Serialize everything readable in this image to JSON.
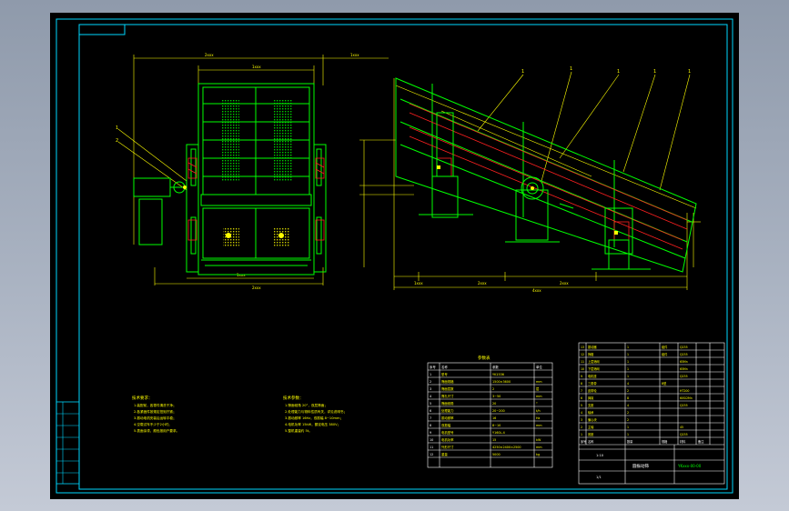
{
  "viewer": {
    "background": "#000000",
    "line_colors": {
      "frame": "#00d8ff",
      "outline": "#00ff00",
      "dimension": "#ffff00",
      "section": "#ff2020",
      "text": "#ffff00",
      "table": "#ffffff"
    },
    "cursor_icon": "crosshair-icon"
  },
  "drawing": {
    "front_view": {
      "dims_top": [
        "2xxx",
        "1xxx",
        "1xxx"
      ],
      "dims_bottom": [
        "1xxx",
        "2xxx"
      ],
      "callouts": [
        "1",
        "2"
      ]
    },
    "side_view": {
      "dims_bottom": [
        "1xxx",
        "2xxx",
        "2xxx",
        "4xxx"
      ],
      "callouts": [
        "1",
        "1",
        "1",
        "1",
        "1"
      ]
    },
    "tech_notes_left": {
      "title": "技术要求：",
      "lines": [
        "1.装配前，各零件清洗干净；",
        "2.各紧固件按规定扭矩拧紧；",
        "3.振动电机安装后运转平稳；",
        "4.空载试车不少于2小时；",
        "5.表面涂漆，颜色按用户要求。"
      ]
    },
    "tech_notes_right": {
      "title": "技术参数：",
      "lines": [
        "1.筛面倾角 20°，双层筛面；",
        "2.处理能力与物料性质有关，详见说明书；",
        "3.振动频率 16Hz，双振幅 8~10mm；",
        "4.电机功率 15kW，额定电压 380V；",
        "5.整机重量约 5t。"
      ]
    },
    "param_table": {
      "title": "参数表",
      "headers": [
        "序号",
        "名称",
        "参数",
        "单位"
      ],
      "rows": [
        [
          "1",
          "型号",
          "YK1536",
          ""
        ],
        [
          "2",
          "筛面规格",
          "1500×3600",
          "mm"
        ],
        [
          "3",
          "筛面层数",
          "2",
          "层"
        ],
        [
          "4",
          "筛孔尺寸",
          "3~50",
          "mm"
        ],
        [
          "5",
          "筛面倾角",
          "20",
          "°"
        ],
        [
          "6",
          "处理能力",
          "20~200",
          "t/h"
        ],
        [
          "7",
          "振动频率",
          "16",
          "Hz"
        ],
        [
          "8",
          "双振幅",
          "8~10",
          "mm"
        ],
        [
          "9",
          "电机型号",
          "Y160L-4",
          ""
        ],
        [
          "10",
          "电机功率",
          "15",
          "kW"
        ],
        [
          "11",
          "外形尺寸",
          "4250×2400×2500",
          "mm"
        ],
        [
          "12",
          "重量",
          "5000",
          "kg"
        ]
      ]
    },
    "parts_list": {
      "rows": [
        [
          "13",
          "振动器",
          "1",
          "组件",
          "Q235",
          ""
        ],
        [
          "12",
          "筛箱",
          "1",
          "组件",
          "Q235",
          ""
        ],
        [
          "11",
          "上层筛网",
          "1",
          "",
          "65Mn",
          ""
        ],
        [
          "10",
          "下层筛网",
          "1",
          "",
          "65Mn",
          ""
        ],
        [
          "9",
          "电机座",
          "1",
          "",
          "Q235",
          ""
        ],
        [
          "8",
          "三角带",
          "4",
          "B型",
          "",
          ""
        ],
        [
          "7",
          "皮带轮",
          "2",
          "",
          "HT200",
          ""
        ],
        [
          "6",
          "弹簧",
          "8",
          "",
          "60Si2Mn",
          ""
        ],
        [
          "5",
          "支座",
          "4",
          "",
          "Q235",
          ""
        ],
        [
          "4",
          "轴承",
          "2",
          "",
          "",
          ""
        ],
        [
          "3",
          "偏心块",
          "2",
          "",
          "",
          ""
        ],
        [
          "2",
          "主轴",
          "1",
          "",
          "45",
          ""
        ],
        [
          "1",
          "底座",
          "1",
          "",
          "Q235",
          ""
        ]
      ],
      "header": [
        "序号",
        "名称",
        "数量",
        "规格",
        "材料",
        "备注"
      ],
      "title_block": {
        "drawing_no": "YKxxx-00-00",
        "name": "圆振动筛",
        "scale": "1:10",
        "sheet": "1/1"
      }
    },
    "left_strip": {
      "labels": [
        "",
        "",
        "",
        "",
        "",
        "",
        ""
      ]
    }
  }
}
